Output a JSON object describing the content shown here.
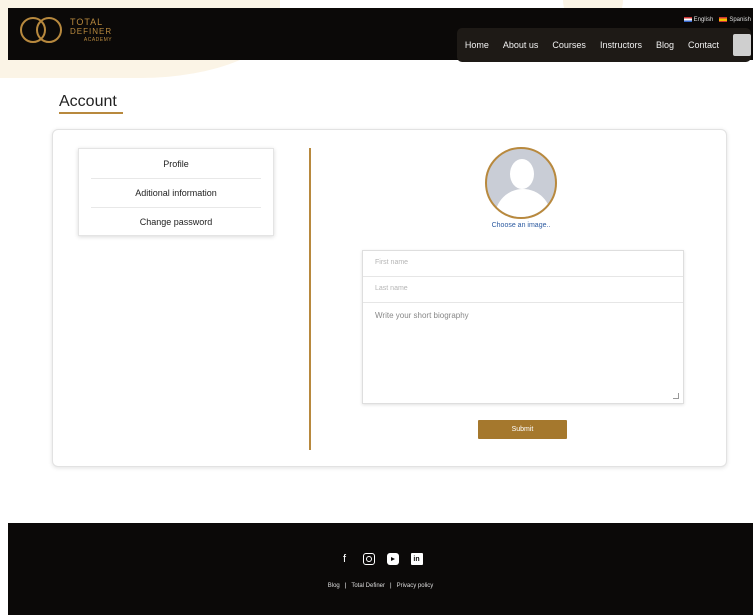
{
  "header": {
    "logo": {
      "line1": "TOTAL",
      "line2": "DEFINER",
      "line3": "ACADEMY"
    },
    "languages": [
      "English",
      "Spanish"
    ],
    "nav": [
      "Home",
      "About us",
      "Courses",
      "Instructors",
      "Blog",
      "Contact"
    ]
  },
  "page": {
    "title": "Account"
  },
  "menu": {
    "items": [
      "Profile",
      "Aditional information",
      "Change password"
    ]
  },
  "profile": {
    "choose_image": "Choose an image..",
    "first_name_placeholder": "First name",
    "last_name_placeholder": "Last name",
    "bio_placeholder": "Write your short biography",
    "submit_label": "Submit"
  },
  "footer": {
    "social_icons": [
      "facebook-icon",
      "instagram-icon",
      "youtube-icon",
      "linkedin-icon"
    ],
    "links": [
      "Blog",
      "Total Definer",
      "Privacy policy"
    ]
  },
  "colors": {
    "accent": "#b8893e",
    "button": "#a5782d",
    "dark": "#0b0908",
    "link": "#2c5aa0"
  }
}
